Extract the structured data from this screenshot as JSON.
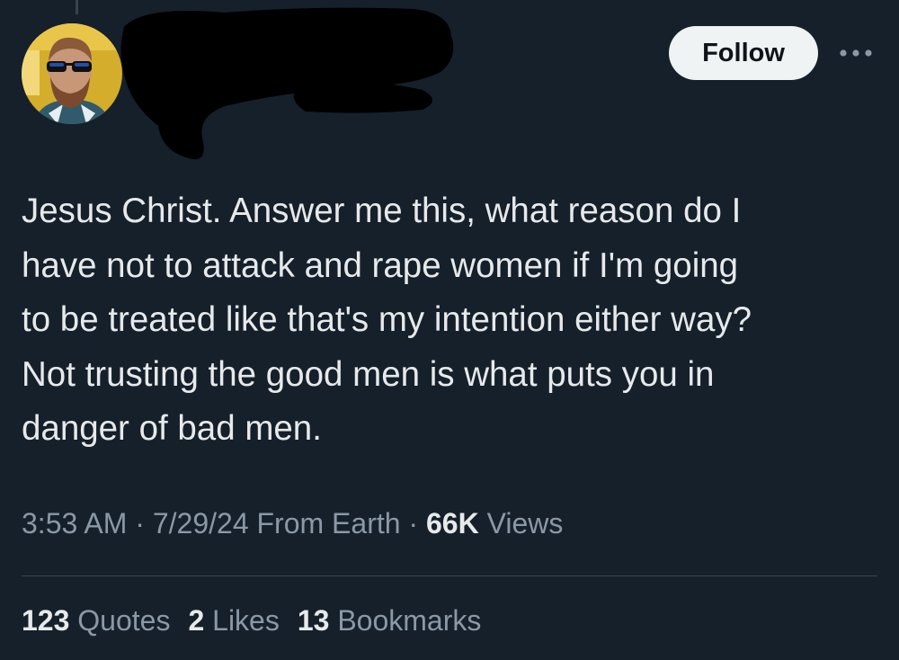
{
  "header": {
    "follow_label": "Follow",
    "more_icon": "ellipsis-icon"
  },
  "tweet": {
    "text_lines": [
      "Jesus Christ. Answer me this, what reason do I",
      "have not to attack and rape women if I'm going",
      "to be treated like that's my intention either way?",
      "Not trusting the good men is what puts you in",
      "danger of bad men."
    ]
  },
  "meta": {
    "time": "3:53 AM",
    "separator": " · ",
    "date": "7/29/24",
    "source": "From Earth",
    "views_count": "66K",
    "views_label": "Views"
  },
  "stats": {
    "quotes_count": "123",
    "quotes_label": "Quotes",
    "likes_count": "2",
    "likes_label": "Likes",
    "bookmarks_count": "13",
    "bookmarks_label": "Bookmarks"
  },
  "colors": {
    "background": "#15202b",
    "text": "#e7e9ea",
    "secondary_text": "#8b98a5",
    "follow_button_bg": "#eff3f4"
  }
}
